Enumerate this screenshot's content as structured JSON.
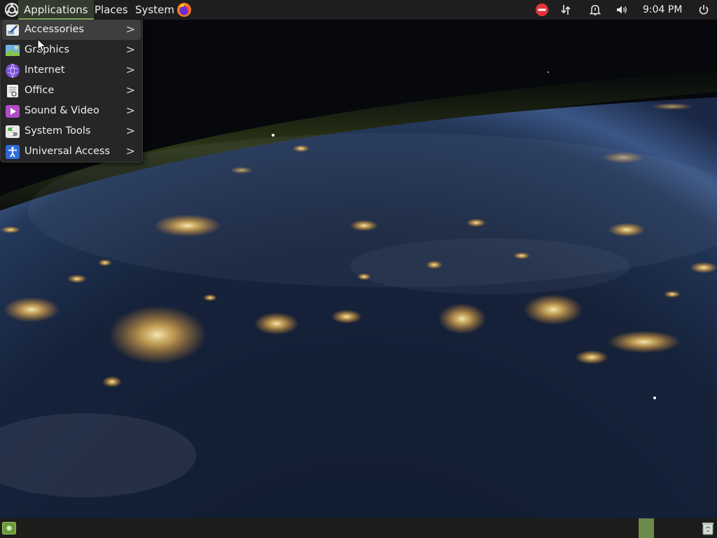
{
  "top_panel": {
    "menus": [
      {
        "label": "Applications"
      },
      {
        "label": "Places"
      },
      {
        "label": "System"
      }
    ],
    "launchers": [
      "firefox-icon"
    ],
    "tray_icons": [
      "do-not-disturb-icon",
      "network-icon",
      "notification-bell-icon",
      "volume-icon"
    ],
    "clock": "9:04 PM",
    "power_icon": "power-icon"
  },
  "app_menu": {
    "selected_index": 0,
    "items": [
      {
        "label": "Accessories",
        "icon": "accessories-icon",
        "arrow": ">"
      },
      {
        "label": "Graphics",
        "icon": "graphics-icon",
        "arrow": ">"
      },
      {
        "label": "Internet",
        "icon": "internet-icon",
        "arrow": ">"
      },
      {
        "label": "Office",
        "icon": "office-icon",
        "arrow": ">"
      },
      {
        "label": "Sound & Video",
        "icon": "sound-video-icon",
        "arrow": ">"
      },
      {
        "label": "System Tools",
        "icon": "system-tools-icon",
        "arrow": ">"
      },
      {
        "label": "Universal Access",
        "icon": "universal-access-icon",
        "arrow": ">"
      }
    ]
  },
  "bottom_panel": {
    "show_desktop_icon": "show-desktop-icon",
    "trash_icon": "trash-icon"
  },
  "colors": {
    "panel_bg": "#1e1e1e",
    "menu_bg": "#262626",
    "accent_green": "#86b35a",
    "workspace_active": "#6c8a4a"
  }
}
